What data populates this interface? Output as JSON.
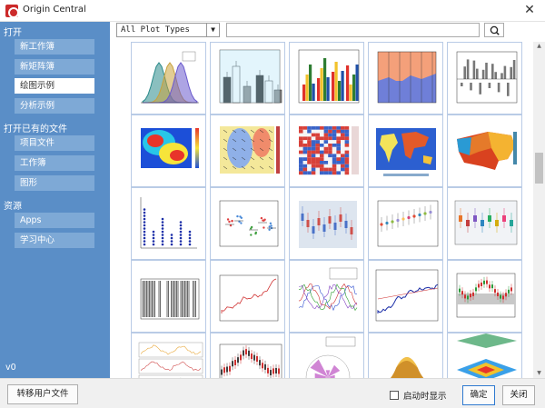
{
  "window": {
    "title": "Origin Central",
    "close_glyph": "✕"
  },
  "sidebar": {
    "sections": [
      {
        "header": "打开",
        "items": [
          {
            "label": "新工作簿"
          },
          {
            "label": "新矩阵簿"
          },
          {
            "label": "绘图示例",
            "active": true
          },
          {
            "label": "分析示例"
          }
        ]
      },
      {
        "header": "打开已有的文件",
        "items": [
          {
            "label": "项目文件"
          },
          {
            "label": "工作簿"
          },
          {
            "label": "图形"
          }
        ]
      },
      {
        "header": "资源",
        "items": [
          {
            "label": "Apps"
          },
          {
            "label": "学习中心"
          }
        ]
      }
    ],
    "version": "v0"
  },
  "toolbar": {
    "plot_type_selected": "All Plot Types",
    "search_placeholder": "",
    "search_icon": "magnifier-icon"
  },
  "gallery": {
    "thumbnails": [
      {
        "kind": "density"
      },
      {
        "kind": "bar-error"
      },
      {
        "kind": "grouped-bar"
      },
      {
        "kind": "stacked-area"
      },
      {
        "kind": "column-gray"
      },
      {
        "kind": "heatmap-contour"
      },
      {
        "kind": "vector-field"
      },
      {
        "kind": "heatmap-bluered"
      },
      {
        "kind": "world-map"
      },
      {
        "kind": "us-map"
      },
      {
        "kind": "dot-columns"
      },
      {
        "kind": "scatter-groups"
      },
      {
        "kind": "box-columns"
      },
      {
        "kind": "scatter-colored"
      },
      {
        "kind": "box-colored"
      },
      {
        "kind": "bar-code"
      },
      {
        "kind": "line-noisy"
      },
      {
        "kind": "multi-line"
      },
      {
        "kind": "stock-line"
      },
      {
        "kind": "candlestick-bands"
      },
      {
        "kind": "multi-panel"
      },
      {
        "kind": "candlestick"
      },
      {
        "kind": "polar-rose"
      },
      {
        "kind": "surface-3d"
      },
      {
        "kind": "mesh-3d"
      }
    ]
  },
  "footer": {
    "transfer_label": "转移用户文件",
    "startup_checkbox_label": "启动时显示",
    "startup_checked": false,
    "ok_label": "确定",
    "close_label": "关闭"
  },
  "colors": {
    "sidebar_bg": "#5a8ec7",
    "sidebar_item_bg": "#7ea9d6",
    "active_item_bg": "#ffffff",
    "thumb_border": "#b9cbe6",
    "accent": "#2f7ad0"
  }
}
